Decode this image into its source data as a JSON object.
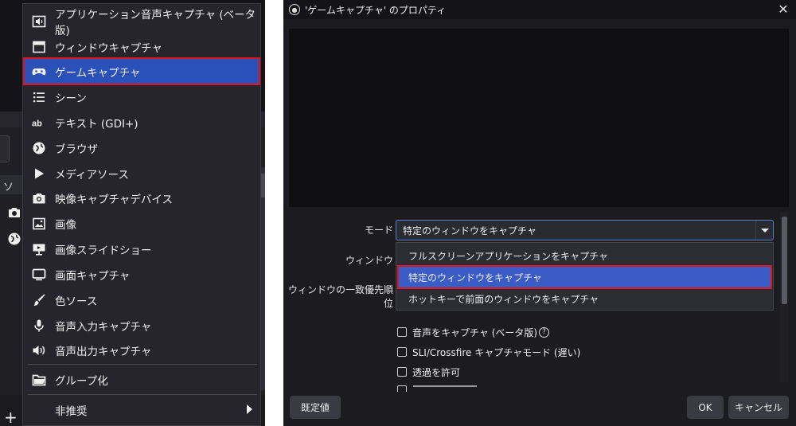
{
  "source_menu": {
    "items": [
      {
        "label": "アプリケーション音声キャプチャ (ベータ版)",
        "icon": "app-audio-capture-icon"
      },
      {
        "label": "ウィンドウキャプチャ",
        "icon": "window-capture-icon"
      },
      {
        "label": "ゲームキャプチャ",
        "icon": "gamepad-icon",
        "selected": true
      },
      {
        "label": "シーン",
        "icon": "scene-list-icon"
      },
      {
        "label": "テキスト (GDI+)",
        "icon": "text-ab-icon"
      },
      {
        "label": "ブラウザ",
        "icon": "globe-icon"
      },
      {
        "label": "メディアソース",
        "icon": "play-icon"
      },
      {
        "label": "映像キャプチャデバイス",
        "icon": "camera-icon"
      },
      {
        "label": "画像",
        "icon": "image-icon"
      },
      {
        "label": "画像スライドショー",
        "icon": "slideshow-icon"
      },
      {
        "label": "画面キャプチャ",
        "icon": "monitor-icon"
      },
      {
        "label": "色ソース",
        "icon": "brush-icon"
      },
      {
        "label": "音声入力キャプチャ",
        "icon": "microphone-icon"
      },
      {
        "label": "音声出力キャプチャ",
        "icon": "speaker-icon"
      }
    ],
    "group": {
      "label": "グループ化",
      "icon": "folder-icon"
    },
    "deprecated": {
      "label": "非推奨",
      "icon": "chevron-right-icon"
    }
  },
  "background": {
    "sources_header": "ソ"
  },
  "dialog": {
    "title": "'ゲームキャプチャ' のプロパティ",
    "mode_label": "モード",
    "mode_value": "特定のウィンドウをキャプチャ",
    "window_label": "ウィンドウ",
    "match_priority_label": "ウィンドウの一致優先順位",
    "mode_options": [
      {
        "label": "フルスクリーンアプリケーションをキャプチャ"
      },
      {
        "label": "特定のウィンドウをキャプチャ",
        "selected": true
      },
      {
        "label": "ホットキーで前面のウィンドウをキャプチャ"
      }
    ],
    "checkboxes": [
      {
        "label": "音声をキャプチャ (ベータ版)",
        "checked": false,
        "help": "?"
      },
      {
        "label": "SLI/Crossfire キャプチャモード (遅い)",
        "checked": false
      },
      {
        "label": "透過を許可",
        "checked": false
      }
    ],
    "defaults_button": "既定値",
    "ok_button": "OK",
    "cancel_button": "キャンセル"
  },
  "colors": {
    "selection": "#2b50b8",
    "highlight_border": "#e0141e",
    "background": "#1f1f24"
  }
}
